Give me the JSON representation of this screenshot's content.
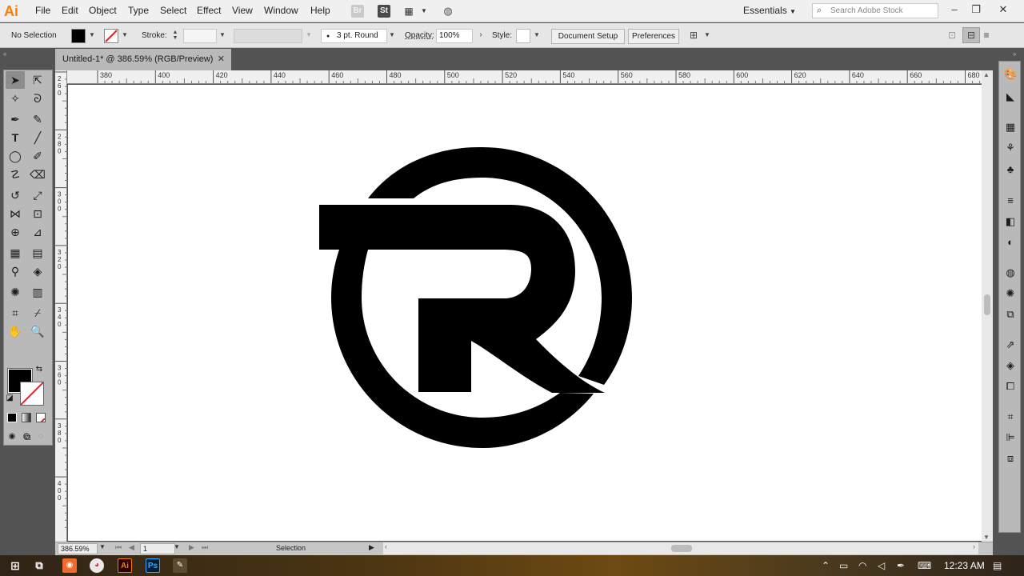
{
  "app": {
    "logo": "Ai",
    "menu": [
      "File",
      "Edit",
      "Object",
      "Type",
      "Select",
      "Effect",
      "View",
      "Window",
      "Help"
    ],
    "bridge_label": "Br",
    "stock_label": "St",
    "workspace": "Essentials",
    "search_placeholder": "Search Adobe Stock"
  },
  "control": {
    "selection": "No Selection",
    "stroke_label": "Stroke:",
    "brush": "3 pt. Round",
    "opacity_label": "Opacity:",
    "opacity_value": "100%",
    "style_label": "Style:",
    "document_setup": "Document Setup",
    "preferences": "Preferences"
  },
  "document": {
    "tab_title": "Untitled-1* @ 386.59% (RGB/Preview)",
    "ruler_h_ticks": [
      "380",
      "400",
      "420",
      "440",
      "460",
      "480",
      "500",
      "520",
      "540",
      "560",
      "580",
      "600",
      "620",
      "640",
      "660",
      "680"
    ],
    "ruler_v_ticks": [
      "2 6 0",
      "2 8 0",
      "3 0 0",
      "3 2 0",
      "3 4 0",
      "3 6 0",
      "3 8 0",
      "4 0 0"
    ]
  },
  "status": {
    "zoom": "386.59%",
    "artboard": "1",
    "tool": "Selection"
  },
  "taskbar": {
    "time": "12:23 AM",
    "ai_label": "Ai",
    "ps_label": "Ps"
  },
  "colors": {
    "accent_ai": "#ff7c00",
    "ps_blue": "#31a8ff",
    "canvas": "#ffffff",
    "logo_fill": "#000000"
  }
}
